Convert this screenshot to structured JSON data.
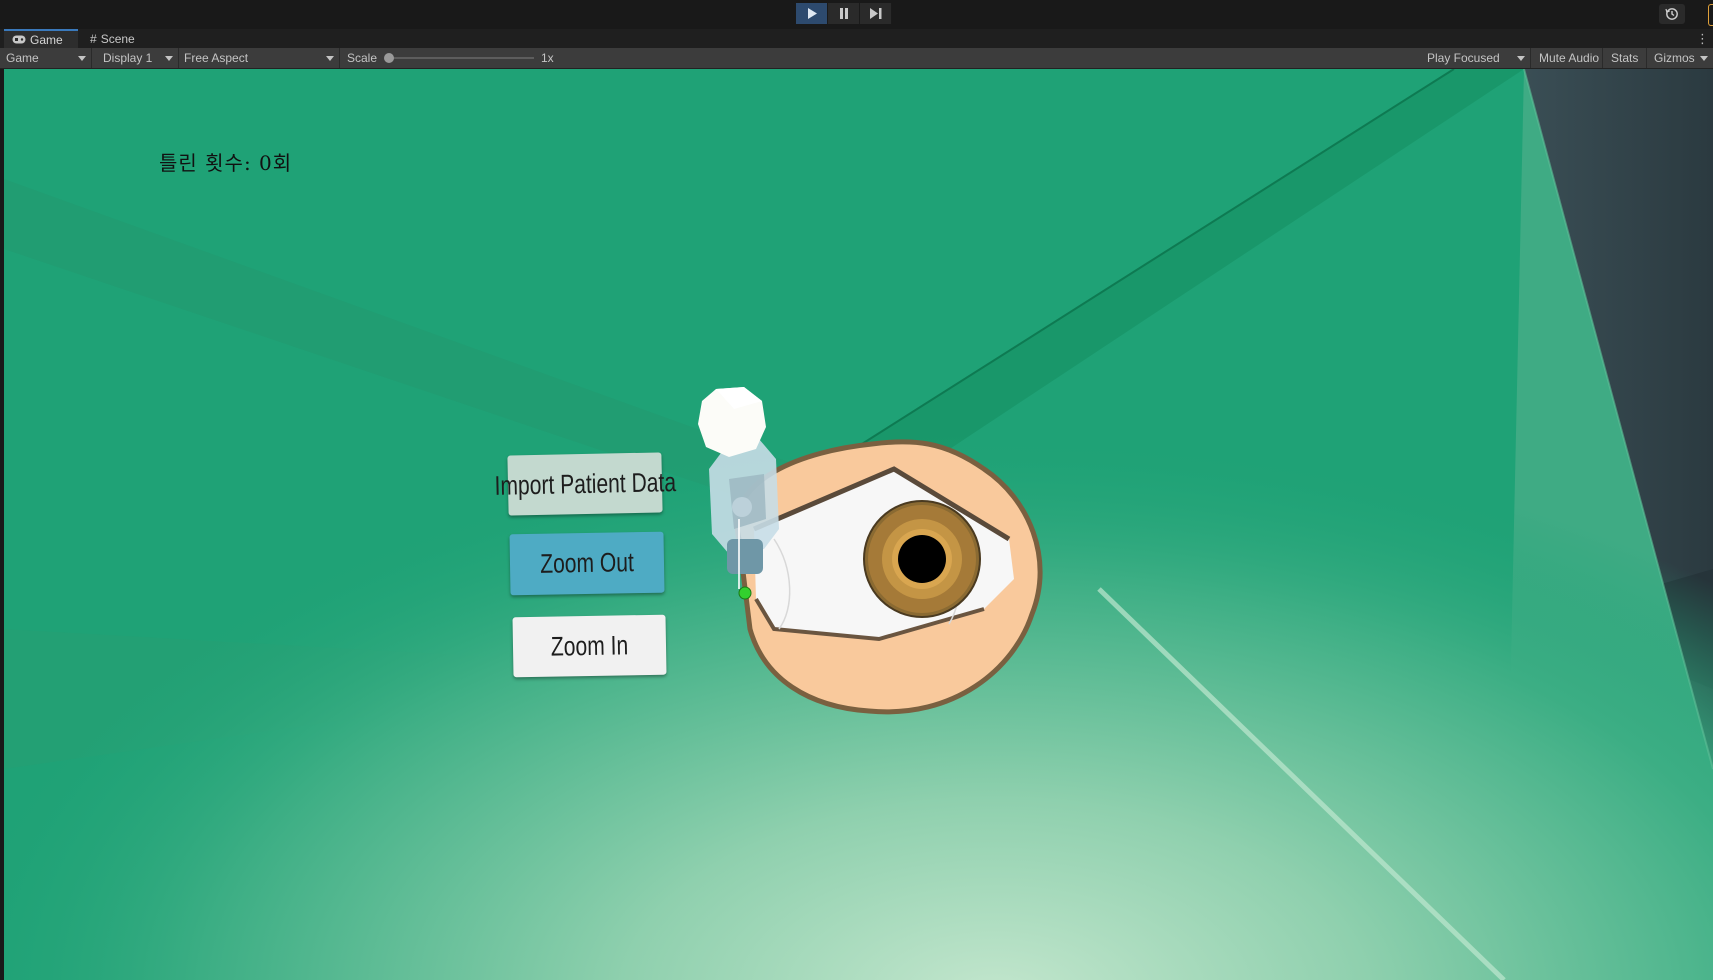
{
  "toolbar": {
    "play_icon": "play-icon",
    "pause_icon": "pause-icon",
    "step_icon": "step-icon",
    "history_icon": "history-icon"
  },
  "tabs": [
    {
      "label": "Game",
      "icon": "gamepad-icon"
    },
    {
      "label": "Scene",
      "icon": "grid-icon"
    }
  ],
  "game_toolbar": {
    "view_select": "Game",
    "display_select": "Display 1",
    "aspect_select": "Free Aspect",
    "scale_label": "Scale",
    "scale_value": "1x",
    "scale_level": 0.0,
    "play_mode_select": "Play Focused",
    "mute_audio": "Mute Audio",
    "stats": "Stats",
    "gizmos": "Gizmos"
  },
  "game": {
    "wrong_count_text": "틀린 횟수: 0회",
    "buttons": {
      "import_patient_data": "Import Patient Data",
      "zoom_out": "Zoom Out",
      "zoom_in": "Zoom In"
    }
  },
  "colors": {
    "accent": "#3a79bb",
    "scene_green": "#1fa276",
    "zoom_out_button": "#4eabc4",
    "import_button": "#c3d9cf",
    "skin": "#f8c89a"
  }
}
